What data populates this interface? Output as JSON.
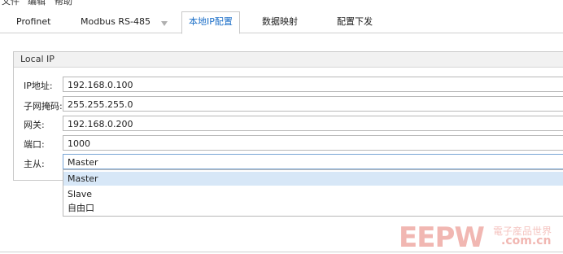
{
  "menubar": {
    "items": [
      "文件",
      "编辑",
      "帮助"
    ]
  },
  "tabs": [
    {
      "label": "Profinet"
    },
    {
      "label": "Modbus RS-485"
    },
    {
      "label": "本地IP配置"
    },
    {
      "label": "数据映射"
    },
    {
      "label": "配置下发"
    }
  ],
  "group": {
    "title": "Local IP",
    "rows": [
      {
        "label": "IP地址:",
        "value": "192.168.0.100"
      },
      {
        "label": "子网掩码:",
        "value": "255.255.255.0"
      },
      {
        "label": "网关:",
        "value": "192.168.0.200"
      },
      {
        "label": "端口:",
        "value": "1000"
      },
      {
        "label": "主从:",
        "value": "Master"
      }
    ]
  },
  "dropdown": {
    "options": [
      "Master",
      "Slave",
      "自由口"
    ]
  },
  "watermark": {
    "brand": "EEPW",
    "cn": "電子産品世界",
    "domain": ".com.cn"
  },
  "colors": {
    "accent": "#1c6fc8",
    "selected_bg": "#d7e7f7",
    "watermark": "#f1b7b2"
  }
}
